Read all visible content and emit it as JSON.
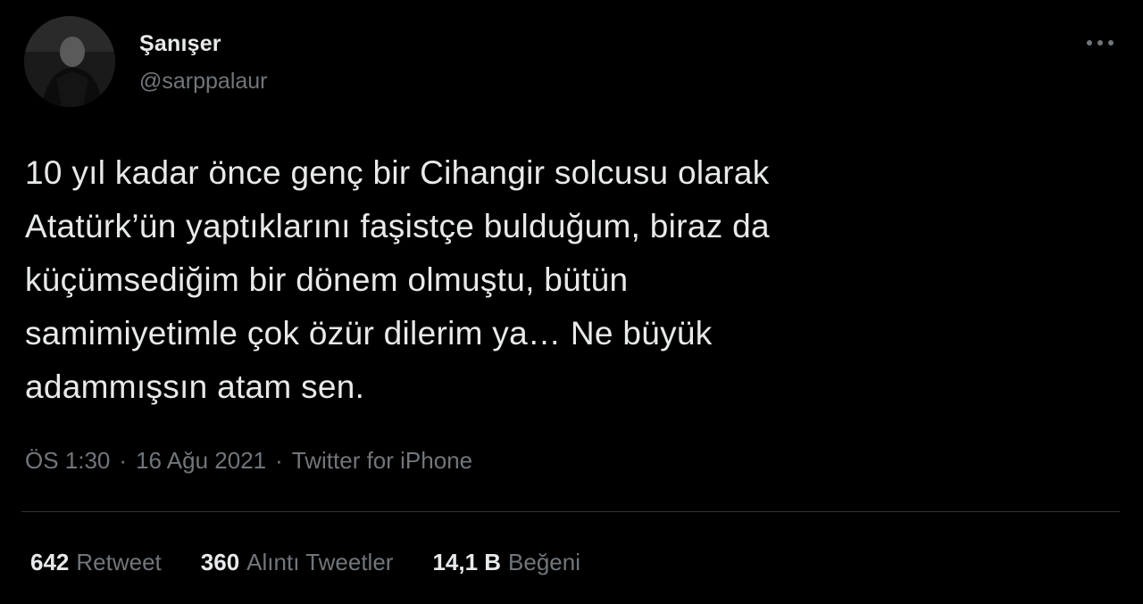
{
  "tweet": {
    "author": {
      "display_name": "Şanışer",
      "handle": "@sarppalaur"
    },
    "more_icon": "ellipsis-icon",
    "text": "10 yıl kadar önce genç bir Cihangir solcusu olarak\nAtatürk’ün yaptıklarını faşistçe bulduğum, biraz da\nküçümsediğim bir dönem olmuştu, bütün\nsamimiyetimle çok özür dilerim ya… Ne büyük\nadammışsın atam sen.",
    "time": "ÖS 1:30",
    "date": "16 Ağu 2021",
    "source": "Twitter for iPhone",
    "separator": "·",
    "stats": {
      "retweets": {
        "count": "642",
        "label": "Retweet"
      },
      "quotes": {
        "count": "360",
        "label": "Alıntı Tweetler"
      },
      "likes": {
        "count": "14,1 B",
        "label": "Beğeni"
      }
    }
  },
  "colors": {
    "background": "#000000",
    "primary_text": "#e7e9ea",
    "secondary_text": "#71767b",
    "divider": "#2f3336"
  }
}
